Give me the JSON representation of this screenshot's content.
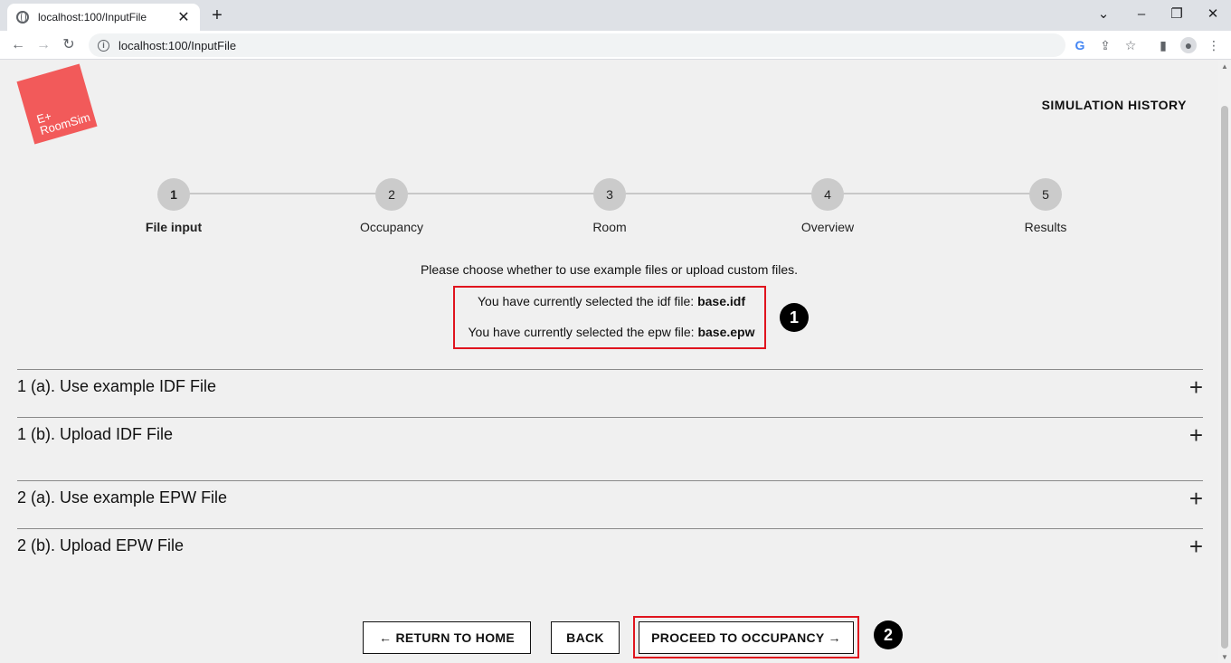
{
  "browser": {
    "tab_title": "localhost:100/InputFile",
    "tab_close": "✕",
    "new_tab": "+",
    "url": "localhost:100/InputFile",
    "window_controls": {
      "dropdown": "⌄",
      "minimize": "–",
      "restore": "❐",
      "close": "✕"
    }
  },
  "header": {
    "logo_text_line1": "E+",
    "logo_text_line2": "RoomSim",
    "nav_link": "SIMULATION HISTORY",
    "logo_color": "#f25a5a"
  },
  "stepper": {
    "steps": [
      {
        "number": "1",
        "label": "File input",
        "active": true
      },
      {
        "number": "2",
        "label": "Occupancy",
        "active": false
      },
      {
        "number": "3",
        "label": "Room",
        "active": false
      },
      {
        "number": "4",
        "label": "Overview",
        "active": false
      },
      {
        "number": "5",
        "label": "Results",
        "active": false
      }
    ]
  },
  "main": {
    "intro": "Please choose whether to use example files or upload custom files.",
    "idf_prefix": "You have currently selected the idf file:",
    "idf_file": "base.idf",
    "epw_prefix": "You have currently selected the epw file:",
    "epw_file": "base.epw",
    "accordions": [
      {
        "title": "1 (a). Use example IDF File",
        "icon": "+"
      },
      {
        "title": "1 (b). Upload IDF File",
        "icon": "+"
      },
      {
        "title": "2 (a). Use example EPW File",
        "icon": "+"
      },
      {
        "title": "2 (b). Upload EPW File",
        "icon": "+"
      }
    ]
  },
  "footer": {
    "return_home": "← RETURN TO HOME",
    "back": "BACK",
    "proceed": "PROCEED TO OCCUPANCY →"
  },
  "annotations": {
    "badge_1": "1",
    "badge_2": "2",
    "highlight_color": "#e0141e"
  }
}
